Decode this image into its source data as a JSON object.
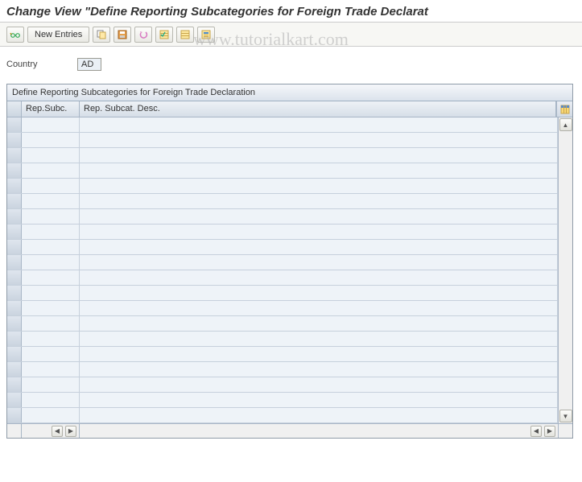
{
  "header": {
    "title": "Change View \"Define Reporting Subcategories for Foreign Trade Declarat"
  },
  "toolbar": {
    "new_entries_label": "New Entries"
  },
  "fields": {
    "country_label": "Country",
    "country_value": "AD"
  },
  "table": {
    "title": "Define Reporting Subcategories for Foreign Trade Declaration",
    "columns": [
      "Rep.Subc.",
      "Rep. Subcat. Desc."
    ],
    "rows": [
      {
        "subc": "",
        "desc": ""
      },
      {
        "subc": "",
        "desc": ""
      },
      {
        "subc": "",
        "desc": ""
      },
      {
        "subc": "",
        "desc": ""
      },
      {
        "subc": "",
        "desc": ""
      },
      {
        "subc": "",
        "desc": ""
      },
      {
        "subc": "",
        "desc": ""
      },
      {
        "subc": "",
        "desc": ""
      },
      {
        "subc": "",
        "desc": ""
      },
      {
        "subc": "",
        "desc": ""
      },
      {
        "subc": "",
        "desc": ""
      },
      {
        "subc": "",
        "desc": ""
      },
      {
        "subc": "",
        "desc": ""
      },
      {
        "subc": "",
        "desc": ""
      },
      {
        "subc": "",
        "desc": ""
      },
      {
        "subc": "",
        "desc": ""
      },
      {
        "subc": "",
        "desc": ""
      },
      {
        "subc": "",
        "desc": ""
      },
      {
        "subc": "",
        "desc": ""
      },
      {
        "subc": "",
        "desc": ""
      }
    ]
  },
  "watermark": "www.tutorialkart.com"
}
